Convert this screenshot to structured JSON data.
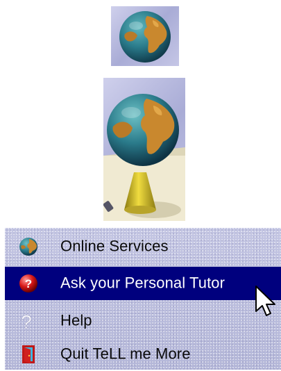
{
  "menu": {
    "items": [
      {
        "label": "Online Services",
        "icon": "globe-icon",
        "selected": false
      },
      {
        "label": "Ask your Personal Tutor",
        "icon": "question-ball-icon",
        "selected": true
      },
      {
        "label": "Help",
        "icon": "question-mark-icon",
        "selected": false
      },
      {
        "label": "Quit TeLL me More",
        "icon": "exit-door-icon",
        "selected": false
      }
    ]
  },
  "colors": {
    "selection": "#00007e",
    "menu_background": "#b9bbdb",
    "globe_ocean": "#2a7a8a",
    "globe_land": "#c9882e",
    "stand": "#d8c229"
  }
}
